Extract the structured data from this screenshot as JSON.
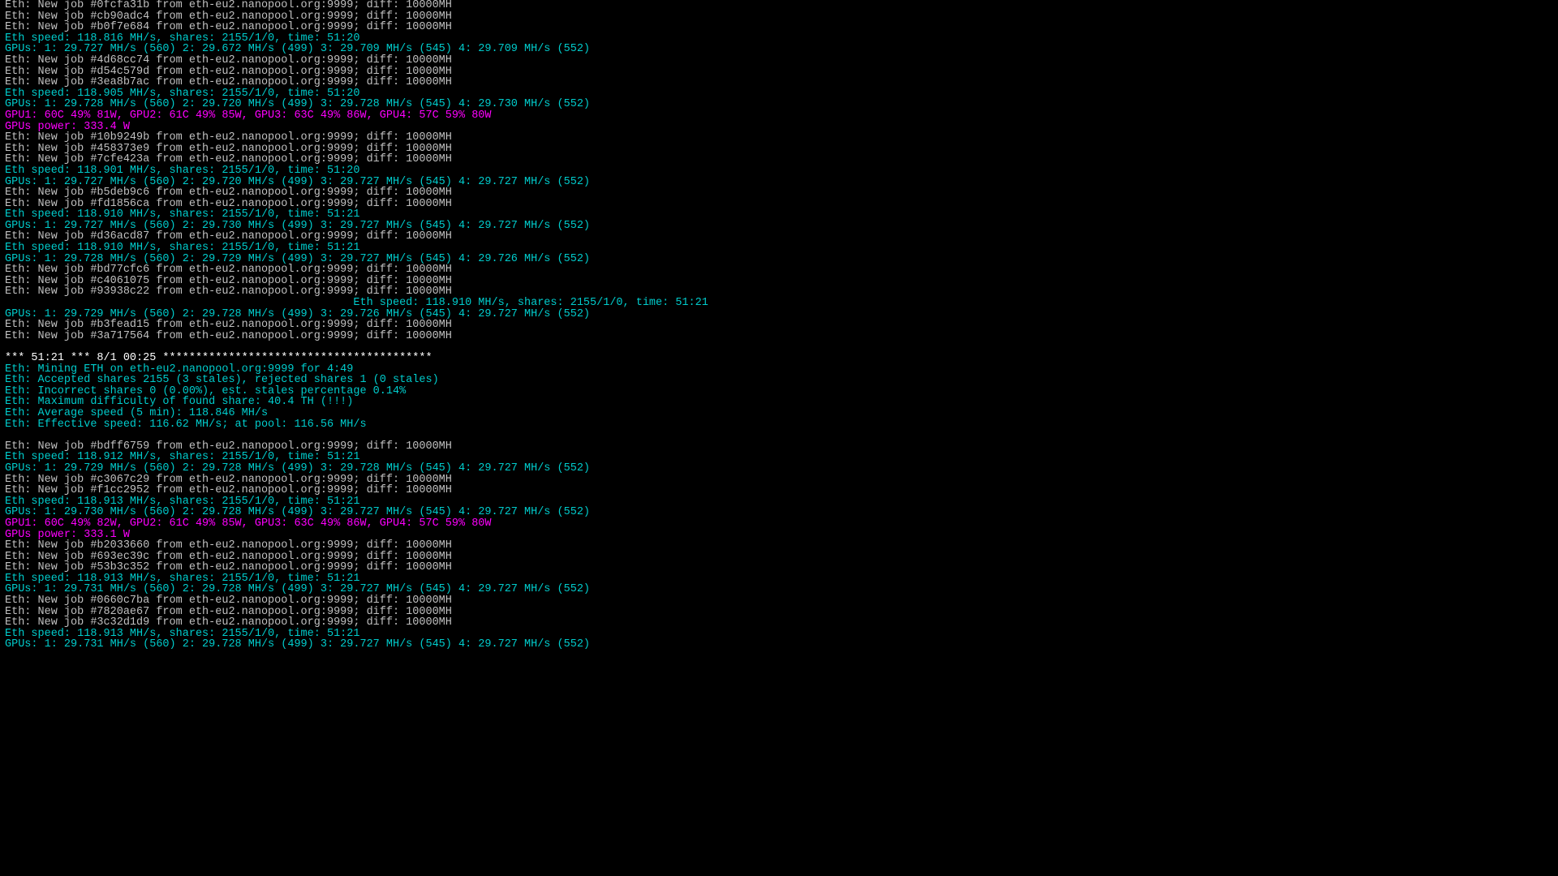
{
  "pool": "eth-eu2.nanopool.org:9999",
  "diff": "10000MH",
  "lines": [
    {
      "t": "job",
      "id": "0fcfa31b"
    },
    {
      "t": "job",
      "id": "cb90adc4"
    },
    {
      "t": "job",
      "id": "b0f7e684"
    },
    {
      "t": "speed",
      "mhs": "118.816",
      "shares": "2155/1/0",
      "time": "51:20"
    },
    {
      "t": "gpus",
      "gpu": [
        {
          "mhs": "29.727",
          "n": "560"
        },
        {
          "mhs": "29.672",
          "n": "499"
        },
        {
          "mhs": "29.709",
          "n": "545"
        },
        {
          "mhs": "29.709",
          "n": "552"
        }
      ]
    },
    {
      "t": "job",
      "id": "4d68cc74"
    },
    {
      "t": "job",
      "id": "d54c579d"
    },
    {
      "t": "job",
      "id": "3ea8b7ac"
    },
    {
      "t": "speed",
      "mhs": "118.905",
      "shares": "2155/1/0",
      "time": "51:20"
    },
    {
      "t": "gpus",
      "gpu": [
        {
          "mhs": "29.728",
          "n": "560"
        },
        {
          "mhs": "29.720",
          "n": "499"
        },
        {
          "mhs": "29.728",
          "n": "545"
        },
        {
          "mhs": "29.730",
          "n": "552"
        }
      ]
    },
    {
      "t": "temps",
      "gpu": [
        {
          "tc": "60C",
          "fan": "49%",
          "w": "81W"
        },
        {
          "tc": "61C",
          "fan": "49%",
          "w": "85W"
        },
        {
          "tc": "63C",
          "fan": "49%",
          "w": "86W"
        },
        {
          "tc": "57C",
          "fan": "59%",
          "w": "80W"
        }
      ]
    },
    {
      "t": "power",
      "w": "333.4"
    },
    {
      "t": "job",
      "id": "10b9249b"
    },
    {
      "t": "job",
      "id": "458373e9"
    },
    {
      "t": "job",
      "id": "7cfe423a"
    },
    {
      "t": "speed",
      "mhs": "118.901",
      "shares": "2155/1/0",
      "time": "51:20"
    },
    {
      "t": "gpus",
      "gpu": [
        {
          "mhs": "29.727",
          "n": "560"
        },
        {
          "mhs": "29.720",
          "n": "499"
        },
        {
          "mhs": "29.727",
          "n": "545"
        },
        {
          "mhs": "29.727",
          "n": "552"
        }
      ]
    },
    {
      "t": "job",
      "id": "b5deb9c6"
    },
    {
      "t": "job",
      "id": "fd1856ca"
    },
    {
      "t": "speed",
      "mhs": "118.910",
      "shares": "2155/1/0",
      "time": "51:21"
    },
    {
      "t": "gpus",
      "gpu": [
        {
          "mhs": "29.727",
          "n": "560"
        },
        {
          "mhs": "29.730",
          "n": "499"
        },
        {
          "mhs": "29.727",
          "n": "545"
        },
        {
          "mhs": "29.727",
          "n": "552"
        }
      ]
    },
    {
      "t": "job",
      "id": "d36acd87"
    },
    {
      "t": "speed",
      "mhs": "118.910",
      "shares": "2155/1/0",
      "time": "51:21"
    },
    {
      "t": "gpus",
      "gpu": [
        {
          "mhs": "29.728",
          "n": "560"
        },
        {
          "mhs": "29.729",
          "n": "499"
        },
        {
          "mhs": "29.727",
          "n": "545"
        },
        {
          "mhs": "29.726",
          "n": "552"
        }
      ]
    },
    {
      "t": "job",
      "id": "bd77cfc6"
    },
    {
      "t": "job",
      "id": "c4061075"
    },
    {
      "t": "job",
      "id": "93938c22"
    },
    {
      "t": "speed_indent",
      "mhs": "118.910",
      "shares": "2155/1/0",
      "time": "51:21"
    },
    {
      "t": "gpus",
      "gpu": [
        {
          "mhs": "29.729",
          "n": "560"
        },
        {
          "mhs": "29.728",
          "n": "499"
        },
        {
          "mhs": "29.726",
          "n": "545"
        },
        {
          "mhs": "29.727",
          "n": "552"
        }
      ]
    },
    {
      "t": "job",
      "id": "b3fead15"
    },
    {
      "t": "job",
      "id": "3a717564"
    },
    {
      "t": "blank"
    },
    {
      "t": "hdr",
      "time": "51:21",
      "date": "8/1 00:25"
    },
    {
      "t": "stat",
      "text": "Eth: Mining ETH on eth-eu2.nanopool.org:9999 for 4:49"
    },
    {
      "t": "stat",
      "text": "Eth: Accepted shares 2155 (3 stales), rejected shares 1 (0 stales)"
    },
    {
      "t": "stat",
      "text": "Eth: Incorrect shares 0 (0.00%), est. stales percentage 0.14%"
    },
    {
      "t": "stat",
      "text": "Eth: Maximum difficulty of found share: 40.4 TH (!!!)"
    },
    {
      "t": "stat",
      "text": "Eth: Average speed (5 min): 118.846 MH/s"
    },
    {
      "t": "stat",
      "text": "Eth: Effective speed: 116.62 MH/s; at pool: 116.56 MH/s"
    },
    {
      "t": "blank"
    },
    {
      "t": "job",
      "id": "bdff6759"
    },
    {
      "t": "speed",
      "mhs": "118.912",
      "shares": "2155/1/0",
      "time": "51:21"
    },
    {
      "t": "gpus",
      "gpu": [
        {
          "mhs": "29.729",
          "n": "560"
        },
        {
          "mhs": "29.728",
          "n": "499"
        },
        {
          "mhs": "29.728",
          "n": "545"
        },
        {
          "mhs": "29.727",
          "n": "552"
        }
      ]
    },
    {
      "t": "job",
      "id": "c3067c29"
    },
    {
      "t": "job",
      "id": "f1cc2952"
    },
    {
      "t": "speed",
      "mhs": "118.913",
      "shares": "2155/1/0",
      "time": "51:21"
    },
    {
      "t": "gpus",
      "gpu": [
        {
          "mhs": "29.730",
          "n": "560"
        },
        {
          "mhs": "29.728",
          "n": "499"
        },
        {
          "mhs": "29.727",
          "n": "545"
        },
        {
          "mhs": "29.727",
          "n": "552"
        }
      ]
    },
    {
      "t": "temps",
      "gpu": [
        {
          "tc": "60C",
          "fan": "49%",
          "w": "82W"
        },
        {
          "tc": "61C",
          "fan": "49%",
          "w": "85W"
        },
        {
          "tc": "63C",
          "fan": "49%",
          "w": "86W"
        },
        {
          "tc": "57C",
          "fan": "59%",
          "w": "80W"
        }
      ]
    },
    {
      "t": "power",
      "w": "333.1"
    },
    {
      "t": "job",
      "id": "b2033660"
    },
    {
      "t": "job",
      "id": "693ec39c"
    },
    {
      "t": "job",
      "id": "53b3c352"
    },
    {
      "t": "speed",
      "mhs": "118.913",
      "shares": "2155/1/0",
      "time": "51:21"
    },
    {
      "t": "gpus",
      "gpu": [
        {
          "mhs": "29.731",
          "n": "560"
        },
        {
          "mhs": "29.728",
          "n": "499"
        },
        {
          "mhs": "29.727",
          "n": "545"
        },
        {
          "mhs": "29.727",
          "n": "552"
        }
      ]
    },
    {
      "t": "job",
      "id": "0660c7ba"
    },
    {
      "t": "job",
      "id": "7820ae67"
    },
    {
      "t": "job",
      "id": "3c32d1d9"
    },
    {
      "t": "speed",
      "mhs": "118.913",
      "shares": "2155/1/0",
      "time": "51:21"
    },
    {
      "t": "gpus",
      "gpu": [
        {
          "mhs": "29.731",
          "n": "560"
        },
        {
          "mhs": "29.728",
          "n": "499"
        },
        {
          "mhs": "29.727",
          "n": "545"
        },
        {
          "mhs": "29.727",
          "n": "552"
        }
      ]
    }
  ]
}
